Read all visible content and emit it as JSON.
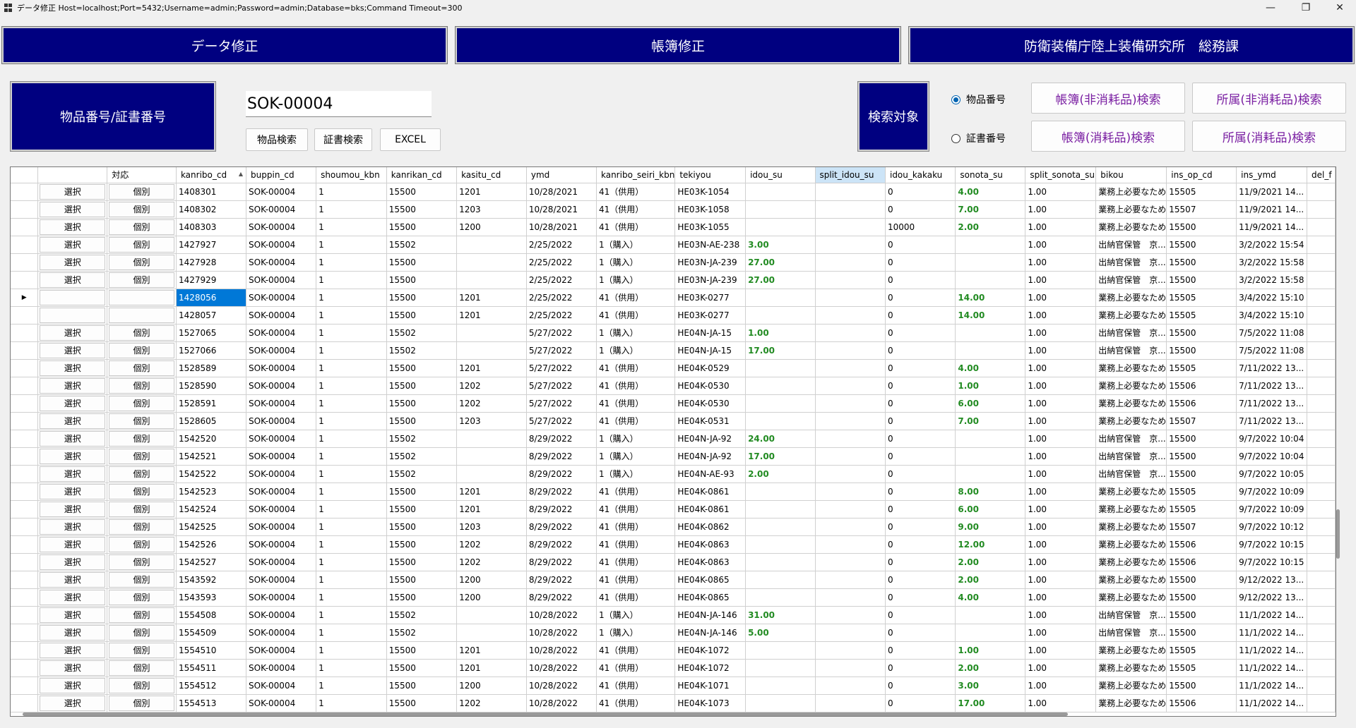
{
  "window": {
    "title": "データ修正 Host=localhost;Port=5432;Username=admin;Password=admin;Database=bks;Command Timeout=300"
  },
  "nav": {
    "data_fix": "データ修正",
    "ledger_fix": "帳簿修正",
    "org": "防衛装備庁陸上装備研究所　総務課"
  },
  "search": {
    "label": "物品番号/証書番号",
    "value": "SOK-00004",
    "item_search": "物品検索",
    "cert_search": "証書検索",
    "excel": "EXCEL",
    "target_label": "検索対象",
    "radio_item": "物品番号",
    "radio_cert": "証書番号",
    "selected_radio": "item",
    "ledger_nonconsumable": "帳簿(非消耗品)検索",
    "belong_nonconsumable": "所属(非消耗品)検索",
    "ledger_consumable": "帳簿(消耗品)検索",
    "belong_consumable": "所属(消耗品)検索"
  },
  "grid": {
    "columns": [
      "",
      "対応",
      "kanribo_cd",
      "buppin_cd",
      "shoumou_kbn",
      "kanrikan_cd",
      "kasitu_cd",
      "ymd",
      "kanribo_seiri_kbn",
      "tekiyou",
      "idou_su",
      "split_idou_su",
      "idou_kakaku",
      "sonota_su",
      "split_sonota_su",
      "bikou",
      "ins_op_cd",
      "ins_ymd",
      "del_f"
    ],
    "sorted_column": "kanribo_cd",
    "selected_header": "split_idou_su",
    "current_row_index": 6,
    "rows": [
      {
        "sel": "選択",
        "act": "個別",
        "kanribo_cd": "1408301",
        "buppin_cd": "SOK-00004",
        "shoumou_kbn": "1",
        "kanrikan_cd": "15500",
        "kasitu_cd": "1201",
        "ymd": "10/28/2021",
        "seiri": "41（供用）",
        "tekiyou": "HE03K-1054",
        "idou_su": "",
        "split_idou_su": "",
        "idou_kakaku": "0",
        "sonota_su": "4.00",
        "split_sonota_su": "1.00",
        "bikou": "業務上必要なため",
        "ins_op_cd": "15505",
        "ins_ymd": "11/9/2021 14..."
      },
      {
        "sel": "選択",
        "act": "個別",
        "kanribo_cd": "1408302",
        "buppin_cd": "SOK-00004",
        "shoumou_kbn": "1",
        "kanrikan_cd": "15500",
        "kasitu_cd": "1203",
        "ymd": "10/28/2021",
        "seiri": "41（供用）",
        "tekiyou": "HE03K-1058",
        "idou_su": "",
        "split_idou_su": "",
        "idou_kakaku": "0",
        "sonota_su": "7.00",
        "split_sonota_su": "1.00",
        "bikou": "業務上必要なため",
        "ins_op_cd": "15507",
        "ins_ymd": "11/9/2021 14..."
      },
      {
        "sel": "選択",
        "act": "個別",
        "kanribo_cd": "1408303",
        "buppin_cd": "SOK-00004",
        "shoumou_kbn": "1",
        "kanrikan_cd": "15500",
        "kasitu_cd": "1200",
        "ymd": "10/28/2021",
        "seiri": "41（供用）",
        "tekiyou": "HE03K-1055",
        "idou_su": "",
        "split_idou_su": "",
        "idou_kakaku": "10000",
        "sonota_su": "2.00",
        "split_sonota_su": "1.00",
        "bikou": "業務上必要なため",
        "ins_op_cd": "15500",
        "ins_ymd": "11/9/2021 14..."
      },
      {
        "sel": "選択",
        "act": "個別",
        "kanribo_cd": "1427927",
        "buppin_cd": "SOK-00004",
        "shoumou_kbn": "1",
        "kanrikan_cd": "15502",
        "kasitu_cd": "",
        "ymd": "2/25/2022",
        "seiri": "1（購入）",
        "tekiyou": "HE03N-AE-238",
        "idou_su": "3.00",
        "split_idou_su": "",
        "idou_kakaku": "0",
        "sonota_su": "",
        "split_sonota_su": "1.00",
        "bikou": "出納官保管　京...",
        "ins_op_cd": "15500",
        "ins_ymd": "3/2/2022 15:54"
      },
      {
        "sel": "選択",
        "act": "個別",
        "kanribo_cd": "1427928",
        "buppin_cd": "SOK-00004",
        "shoumou_kbn": "1",
        "kanrikan_cd": "15500",
        "kasitu_cd": "",
        "ymd": "2/25/2022",
        "seiri": "1（購入）",
        "tekiyou": "HE03N-JA-239",
        "idou_su": "27.00",
        "split_idou_su": "",
        "idou_kakaku": "0",
        "sonota_su": "",
        "split_sonota_su": "1.00",
        "bikou": "出納官保管　京...",
        "ins_op_cd": "15500",
        "ins_ymd": "3/2/2022 15:58"
      },
      {
        "sel": "選択",
        "act": "個別",
        "kanribo_cd": "1427929",
        "buppin_cd": "SOK-00004",
        "shoumou_kbn": "1",
        "kanrikan_cd": "15500",
        "kasitu_cd": "",
        "ymd": "2/25/2022",
        "seiri": "1（購入）",
        "tekiyou": "HE03N-JA-239",
        "idou_su": "27.00",
        "split_idou_su": "",
        "idou_kakaku": "0",
        "sonota_su": "",
        "split_sonota_su": "1.00",
        "bikou": "出納官保管　京...",
        "ins_op_cd": "15500",
        "ins_ymd": "3/2/2022 15:58"
      },
      {
        "sel": "",
        "act": "",
        "kanribo_cd": "1428056",
        "buppin_cd": "SOK-00004",
        "shoumou_kbn": "1",
        "kanrikan_cd": "15500",
        "kasitu_cd": "1201",
        "ymd": "2/25/2022",
        "seiri": "41（供用）",
        "tekiyou": "HE03K-0277",
        "idou_su": "",
        "split_idou_su": "",
        "idou_kakaku": "0",
        "sonota_su": "14.00",
        "split_sonota_su": "1.00",
        "bikou": "業務上必要なため",
        "ins_op_cd": "15505",
        "ins_ymd": "3/4/2022 15:10"
      },
      {
        "sel": "",
        "act": "",
        "kanribo_cd": "1428057",
        "buppin_cd": "SOK-00004",
        "shoumou_kbn": "1",
        "kanrikan_cd": "15500",
        "kasitu_cd": "1201",
        "ymd": "2/25/2022",
        "seiri": "41（供用）",
        "tekiyou": "HE03K-0277",
        "idou_su": "",
        "split_idou_su": "",
        "idou_kakaku": "0",
        "sonota_su": "14.00",
        "split_sonota_su": "1.00",
        "bikou": "業務上必要なため",
        "ins_op_cd": "15505",
        "ins_ymd": "3/4/2022 15:10"
      },
      {
        "sel": "選択",
        "act": "個別",
        "kanribo_cd": "1527065",
        "buppin_cd": "SOK-00004",
        "shoumou_kbn": "1",
        "kanrikan_cd": "15502",
        "kasitu_cd": "",
        "ymd": "5/27/2022",
        "seiri": "1（購入）",
        "tekiyou": "HE04N-JA-15",
        "idou_su": "1.00",
        "split_idou_su": "",
        "idou_kakaku": "0",
        "sonota_su": "",
        "split_sonota_su": "1.00",
        "bikou": "出納官保管　京...",
        "ins_op_cd": "15500",
        "ins_ymd": "7/5/2022 11:08"
      },
      {
        "sel": "選択",
        "act": "個別",
        "kanribo_cd": "1527066",
        "buppin_cd": "SOK-00004",
        "shoumou_kbn": "1",
        "kanrikan_cd": "15502",
        "kasitu_cd": "",
        "ymd": "5/27/2022",
        "seiri": "1（購入）",
        "tekiyou": "HE04N-JA-15",
        "idou_su": "17.00",
        "split_idou_su": "",
        "idou_kakaku": "0",
        "sonota_su": "",
        "split_sonota_su": "1.00",
        "bikou": "出納官保管　京...",
        "ins_op_cd": "15500",
        "ins_ymd": "7/5/2022 11:08"
      },
      {
        "sel": "選択",
        "act": "個別",
        "kanribo_cd": "1528589",
        "buppin_cd": "SOK-00004",
        "shoumou_kbn": "1",
        "kanrikan_cd": "15500",
        "kasitu_cd": "1201",
        "ymd": "5/27/2022",
        "seiri": "41（供用）",
        "tekiyou": "HE04K-0529",
        "idou_su": "",
        "split_idou_su": "",
        "idou_kakaku": "0",
        "sonota_su": "4.00",
        "split_sonota_su": "1.00",
        "bikou": "業務上必要なため",
        "ins_op_cd": "15505",
        "ins_ymd": "7/11/2022 13..."
      },
      {
        "sel": "選択",
        "act": "個別",
        "kanribo_cd": "1528590",
        "buppin_cd": "SOK-00004",
        "shoumou_kbn": "1",
        "kanrikan_cd": "15500",
        "kasitu_cd": "1202",
        "ymd": "5/27/2022",
        "seiri": "41（供用）",
        "tekiyou": "HE04K-0530",
        "idou_su": "",
        "split_idou_su": "",
        "idou_kakaku": "0",
        "sonota_su": "1.00",
        "split_sonota_su": "1.00",
        "bikou": "業務上必要なため",
        "ins_op_cd": "15506",
        "ins_ymd": "7/11/2022 13..."
      },
      {
        "sel": "選択",
        "act": "個別",
        "kanribo_cd": "1528591",
        "buppin_cd": "SOK-00004",
        "shoumou_kbn": "1",
        "kanrikan_cd": "15500",
        "kasitu_cd": "1202",
        "ymd": "5/27/2022",
        "seiri": "41（供用）",
        "tekiyou": "HE04K-0530",
        "idou_su": "",
        "split_idou_su": "",
        "idou_kakaku": "0",
        "sonota_su": "6.00",
        "split_sonota_su": "1.00",
        "bikou": "業務上必要なため",
        "ins_op_cd": "15506",
        "ins_ymd": "7/11/2022 13..."
      },
      {
        "sel": "選択",
        "act": "個別",
        "kanribo_cd": "1528605",
        "buppin_cd": "SOK-00004",
        "shoumou_kbn": "1",
        "kanrikan_cd": "15500",
        "kasitu_cd": "1203",
        "ymd": "5/27/2022",
        "seiri": "41（供用）",
        "tekiyou": "HE04K-0531",
        "idou_su": "",
        "split_idou_su": "",
        "idou_kakaku": "0",
        "sonota_su": "7.00",
        "split_sonota_su": "1.00",
        "bikou": "業務上必要なため",
        "ins_op_cd": "15507",
        "ins_ymd": "7/11/2022 13..."
      },
      {
        "sel": "選択",
        "act": "個別",
        "kanribo_cd": "1542520",
        "buppin_cd": "SOK-00004",
        "shoumou_kbn": "1",
        "kanrikan_cd": "15502",
        "kasitu_cd": "",
        "ymd": "8/29/2022",
        "seiri": "1（購入）",
        "tekiyou": "HE04N-JA-92",
        "idou_su": "24.00",
        "split_idou_su": "",
        "idou_kakaku": "0",
        "sonota_su": "",
        "split_sonota_su": "1.00",
        "bikou": "出納官保管　京...",
        "ins_op_cd": "15500",
        "ins_ymd": "9/7/2022 10:04"
      },
      {
        "sel": "選択",
        "act": "個別",
        "kanribo_cd": "1542521",
        "buppin_cd": "SOK-00004",
        "shoumou_kbn": "1",
        "kanrikan_cd": "15502",
        "kasitu_cd": "",
        "ymd": "8/29/2022",
        "seiri": "1（購入）",
        "tekiyou": "HE04N-JA-92",
        "idou_su": "17.00",
        "split_idou_su": "",
        "idou_kakaku": "0",
        "sonota_su": "",
        "split_sonota_su": "1.00",
        "bikou": "出納官保管　京...",
        "ins_op_cd": "15500",
        "ins_ymd": "9/7/2022 10:04"
      },
      {
        "sel": "選択",
        "act": "個別",
        "kanribo_cd": "1542522",
        "buppin_cd": "SOK-00004",
        "shoumou_kbn": "1",
        "kanrikan_cd": "15502",
        "kasitu_cd": "",
        "ymd": "8/29/2022",
        "seiri": "1（購入）",
        "tekiyou": "HE04N-AE-93",
        "idou_su": "2.00",
        "split_idou_su": "",
        "idou_kakaku": "0",
        "sonota_su": "",
        "split_sonota_su": "1.00",
        "bikou": "出納官保管　京...",
        "ins_op_cd": "15500",
        "ins_ymd": "9/7/2022 10:05"
      },
      {
        "sel": "選択",
        "act": "個別",
        "kanribo_cd": "1542523",
        "buppin_cd": "SOK-00004",
        "shoumou_kbn": "1",
        "kanrikan_cd": "15500",
        "kasitu_cd": "1201",
        "ymd": "8/29/2022",
        "seiri": "41（供用）",
        "tekiyou": "HE04K-0861",
        "idou_su": "",
        "split_idou_su": "",
        "idou_kakaku": "0",
        "sonota_su": "8.00",
        "split_sonota_su": "1.00",
        "bikou": "業務上必要なため",
        "ins_op_cd": "15505",
        "ins_ymd": "9/7/2022 10:09"
      },
      {
        "sel": "選択",
        "act": "個別",
        "kanribo_cd": "1542524",
        "buppin_cd": "SOK-00004",
        "shoumou_kbn": "1",
        "kanrikan_cd": "15500",
        "kasitu_cd": "1201",
        "ymd": "8/29/2022",
        "seiri": "41（供用）",
        "tekiyou": "HE04K-0861",
        "idou_su": "",
        "split_idou_su": "",
        "idou_kakaku": "0",
        "sonota_su": "6.00",
        "split_sonota_su": "1.00",
        "bikou": "業務上必要なため",
        "ins_op_cd": "15505",
        "ins_ymd": "9/7/2022 10:09"
      },
      {
        "sel": "選択",
        "act": "個別",
        "kanribo_cd": "1542525",
        "buppin_cd": "SOK-00004",
        "shoumou_kbn": "1",
        "kanrikan_cd": "15500",
        "kasitu_cd": "1203",
        "ymd": "8/29/2022",
        "seiri": "41（供用）",
        "tekiyou": "HE04K-0862",
        "idou_su": "",
        "split_idou_su": "",
        "idou_kakaku": "0",
        "sonota_su": "9.00",
        "split_sonota_su": "1.00",
        "bikou": "業務上必要なため",
        "ins_op_cd": "15507",
        "ins_ymd": "9/7/2022 10:12"
      },
      {
        "sel": "選択",
        "act": "個別",
        "kanribo_cd": "1542526",
        "buppin_cd": "SOK-00004",
        "shoumou_kbn": "1",
        "kanrikan_cd": "15500",
        "kasitu_cd": "1202",
        "ymd": "8/29/2022",
        "seiri": "41（供用）",
        "tekiyou": "HE04K-0863",
        "idou_su": "",
        "split_idou_su": "",
        "idou_kakaku": "0",
        "sonota_su": "12.00",
        "split_sonota_su": "1.00",
        "bikou": "業務上必要なため",
        "ins_op_cd": "15506",
        "ins_ymd": "9/7/2022 10:15"
      },
      {
        "sel": "選択",
        "act": "個別",
        "kanribo_cd": "1542527",
        "buppin_cd": "SOK-00004",
        "shoumou_kbn": "1",
        "kanrikan_cd": "15500",
        "kasitu_cd": "1202",
        "ymd": "8/29/2022",
        "seiri": "41（供用）",
        "tekiyou": "HE04K-0863",
        "idou_su": "",
        "split_idou_su": "",
        "idou_kakaku": "0",
        "sonota_su": "2.00",
        "split_sonota_su": "1.00",
        "bikou": "業務上必要なため",
        "ins_op_cd": "15506",
        "ins_ymd": "9/7/2022 10:15"
      },
      {
        "sel": "選択",
        "act": "個別",
        "kanribo_cd": "1543592",
        "buppin_cd": "SOK-00004",
        "shoumou_kbn": "1",
        "kanrikan_cd": "15500",
        "kasitu_cd": "1200",
        "ymd": "8/29/2022",
        "seiri": "41（供用）",
        "tekiyou": "HE04K-0865",
        "idou_su": "",
        "split_idou_su": "",
        "idou_kakaku": "0",
        "sonota_su": "2.00",
        "split_sonota_su": "1.00",
        "bikou": "業務上必要なため",
        "ins_op_cd": "15500",
        "ins_ymd": "9/12/2022 13..."
      },
      {
        "sel": "選択",
        "act": "個別",
        "kanribo_cd": "1543593",
        "buppin_cd": "SOK-00004",
        "shoumou_kbn": "1",
        "kanrikan_cd": "15500",
        "kasitu_cd": "1200",
        "ymd": "8/29/2022",
        "seiri": "41（供用）",
        "tekiyou": "HE04K-0865",
        "idou_su": "",
        "split_idou_su": "",
        "idou_kakaku": "0",
        "sonota_su": "4.00",
        "split_sonota_su": "1.00",
        "bikou": "業務上必要なため",
        "ins_op_cd": "15500",
        "ins_ymd": "9/12/2022 13..."
      },
      {
        "sel": "選択",
        "act": "個別",
        "kanribo_cd": "1554508",
        "buppin_cd": "SOK-00004",
        "shoumou_kbn": "1",
        "kanrikan_cd": "15502",
        "kasitu_cd": "",
        "ymd": "10/28/2022",
        "seiri": "1（購入）",
        "tekiyou": "HE04N-JA-146",
        "idou_su": "31.00",
        "split_idou_su": "",
        "idou_kakaku": "0",
        "sonota_su": "",
        "split_sonota_su": "1.00",
        "bikou": "出納官保管　京...",
        "ins_op_cd": "15500",
        "ins_ymd": "11/1/2022 14..."
      },
      {
        "sel": "選択",
        "act": "個別",
        "kanribo_cd": "1554509",
        "buppin_cd": "SOK-00004",
        "shoumou_kbn": "1",
        "kanrikan_cd": "15502",
        "kasitu_cd": "",
        "ymd": "10/28/2022",
        "seiri": "1（購入）",
        "tekiyou": "HE04N-JA-146",
        "idou_su": "5.00",
        "split_idou_su": "",
        "idou_kakaku": "0",
        "sonota_su": "",
        "split_sonota_su": "1.00",
        "bikou": "出納官保管　京...",
        "ins_op_cd": "15500",
        "ins_ymd": "11/1/2022 14..."
      },
      {
        "sel": "選択",
        "act": "個別",
        "kanribo_cd": "1554510",
        "buppin_cd": "SOK-00004",
        "shoumou_kbn": "1",
        "kanrikan_cd": "15500",
        "kasitu_cd": "1201",
        "ymd": "10/28/2022",
        "seiri": "41（供用）",
        "tekiyou": "HE04K-1072",
        "idou_su": "",
        "split_idou_su": "",
        "idou_kakaku": "0",
        "sonota_su": "1.00",
        "split_sonota_su": "1.00",
        "bikou": "業務上必要なため",
        "ins_op_cd": "15505",
        "ins_ymd": "11/1/2022 14..."
      },
      {
        "sel": "選択",
        "act": "個別",
        "kanribo_cd": "1554511",
        "buppin_cd": "SOK-00004",
        "shoumou_kbn": "1",
        "kanrikan_cd": "15500",
        "kasitu_cd": "1201",
        "ymd": "10/28/2022",
        "seiri": "41（供用）",
        "tekiyou": "HE04K-1072",
        "idou_su": "",
        "split_idou_su": "",
        "idou_kakaku": "0",
        "sonota_su": "2.00",
        "split_sonota_su": "1.00",
        "bikou": "業務上必要なため",
        "ins_op_cd": "15505",
        "ins_ymd": "11/1/2022 14..."
      },
      {
        "sel": "選択",
        "act": "個別",
        "kanribo_cd": "1554512",
        "buppin_cd": "SOK-00004",
        "shoumou_kbn": "1",
        "kanrikan_cd": "15500",
        "kasitu_cd": "1200",
        "ymd": "10/28/2022",
        "seiri": "41（供用）",
        "tekiyou": "HE04K-1071",
        "idou_su": "",
        "split_idou_su": "",
        "idou_kakaku": "0",
        "sonota_su": "3.00",
        "split_sonota_su": "1.00",
        "bikou": "業務上必要なため",
        "ins_op_cd": "15500",
        "ins_ymd": "11/1/2022 14..."
      },
      {
        "sel": "選択",
        "act": "個別",
        "kanribo_cd": "1554513",
        "buppin_cd": "SOK-00004",
        "shoumou_kbn": "1",
        "kanrikan_cd": "15500",
        "kasitu_cd": "1202",
        "ymd": "10/28/2022",
        "seiri": "41（供用）",
        "tekiyou": "HE04K-1073",
        "idou_su": "",
        "split_idou_su": "",
        "idou_kakaku": "0",
        "sonota_su": "17.00",
        "split_sonota_su": "1.00",
        "bikou": "業務上必要なため",
        "ins_op_cd": "15506",
        "ins_ymd": "11/1/2022 14..."
      }
    ]
  }
}
